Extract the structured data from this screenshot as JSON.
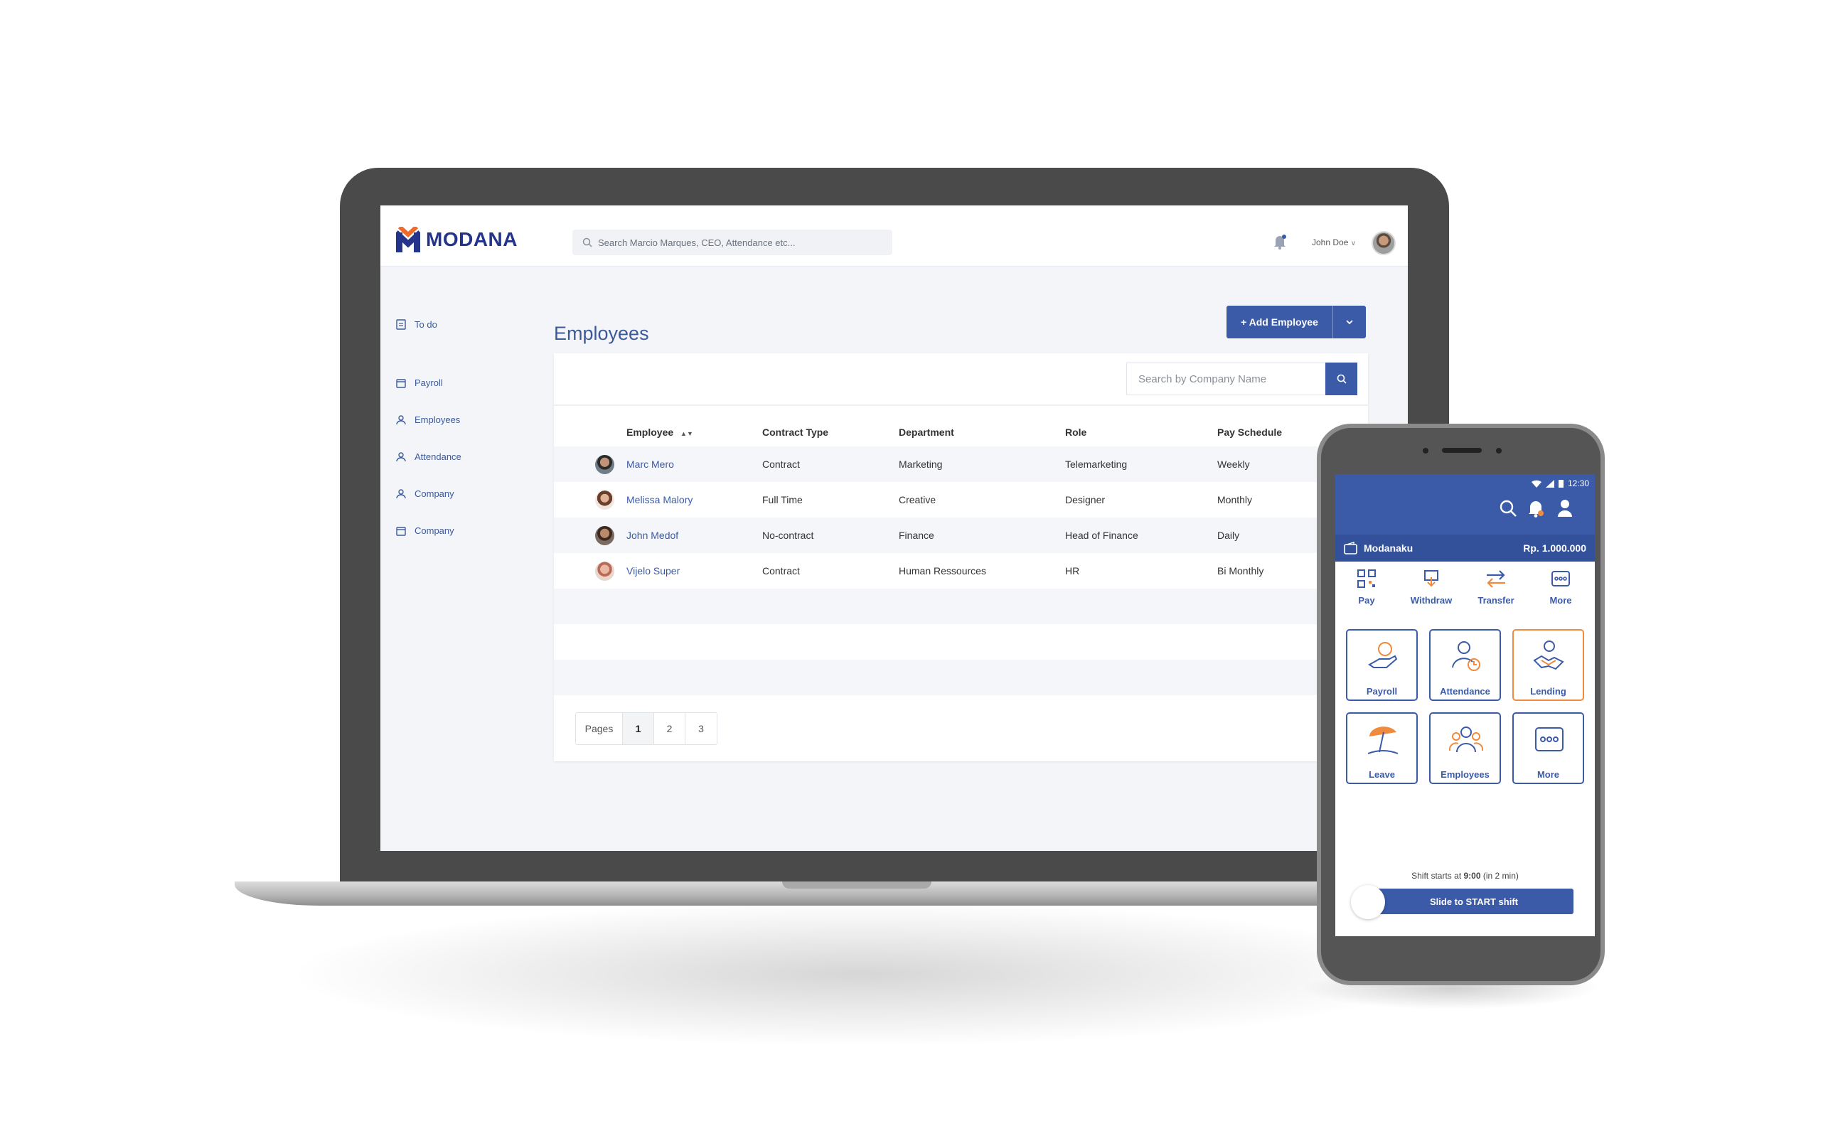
{
  "app": {
    "brand": "MODANA",
    "search_placeholder": "Search Marcio Marques, CEO, Attendance etc...",
    "user_name": "John Doe",
    "accent": "#3b5ba8"
  },
  "sidebar": {
    "items": [
      {
        "label": "To do",
        "icon": "clipboard-icon"
      },
      {
        "label": "Payroll",
        "icon": "calendar-icon"
      },
      {
        "label": "Employees",
        "icon": "user-icon"
      },
      {
        "label": "Attendance",
        "icon": "user-icon"
      },
      {
        "label": "Company",
        "icon": "user-icon"
      },
      {
        "label": "Company",
        "icon": "calendar-icon"
      }
    ]
  },
  "main": {
    "title": "Employees",
    "add_button": "+ Add Employee",
    "search_placeholder": "Search by Company Name",
    "columns": [
      "Employee",
      "Contract Type",
      "Department",
      "Role",
      "Pay Schedule"
    ],
    "rows": [
      {
        "name": "Marc Mero",
        "contract": "Contract",
        "department": "Marketing",
        "role": "Telemarketing",
        "schedule": "Weekly"
      },
      {
        "name": "Melissa Malory",
        "contract": "Full Time",
        "department": "Creative",
        "role": "Designer",
        "schedule": "Monthly"
      },
      {
        "name": "John Medof",
        "contract": "No-contract",
        "department": "Finance",
        "role": "Head of Finance",
        "schedule": "Daily"
      },
      {
        "name": "Vijelo Super",
        "contract": "Contract",
        "department": "Human Ressources",
        "role": "HR",
        "schedule": "Bi Monthly"
      }
    ],
    "pager": {
      "label": "Pages",
      "pages": [
        "1",
        "2",
        "3"
      ],
      "current": "1"
    }
  },
  "phone": {
    "time": "12:30",
    "wallet_name": "Modanaku",
    "balance": "Rp. 1.000.000",
    "quick_actions": [
      "Pay",
      "Withdraw",
      "Transfer",
      "More"
    ],
    "tiles": [
      "Payroll",
      "Attendance",
      "Lending",
      "Leave",
      "Employees",
      "More"
    ],
    "shift_prefix": "Shift starts at ",
    "shift_time": "9:00",
    "shift_suffix": " (in 2 min)",
    "slide_label": "Slide to START shift"
  }
}
